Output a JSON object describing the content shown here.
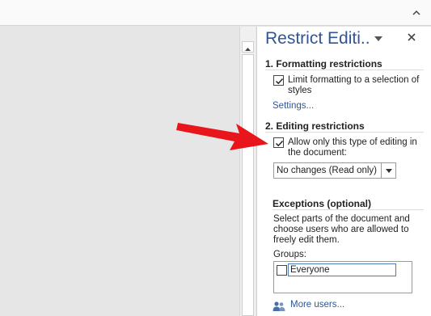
{
  "pane": {
    "title": "Restrict Editi..",
    "close_icon": "close-icon",
    "menu_icon": "chevron-down-icon"
  },
  "formatting": {
    "heading": "1. Formatting restrictions",
    "checkbox_checked": true,
    "checkbox_label": "Limit formatting to a selection of styles",
    "settings_link": "Settings..."
  },
  "editing": {
    "heading": "2. Editing restrictions",
    "checkbox_checked": true,
    "checkbox_label": "Allow only this type of editing in the document:",
    "dropdown_value": "No changes (Read only)"
  },
  "exceptions": {
    "heading": "Exceptions (optional)",
    "description": "Select parts of the document and choose users who are allowed to freely edit them.",
    "groups_label": "Groups:",
    "groups": [
      {
        "name": "Everyone",
        "checked": false
      }
    ],
    "more_users_link": "More users..."
  },
  "colors": {
    "title": "#2f5597",
    "link": "#2b579a",
    "arrow": "#e8151a"
  }
}
